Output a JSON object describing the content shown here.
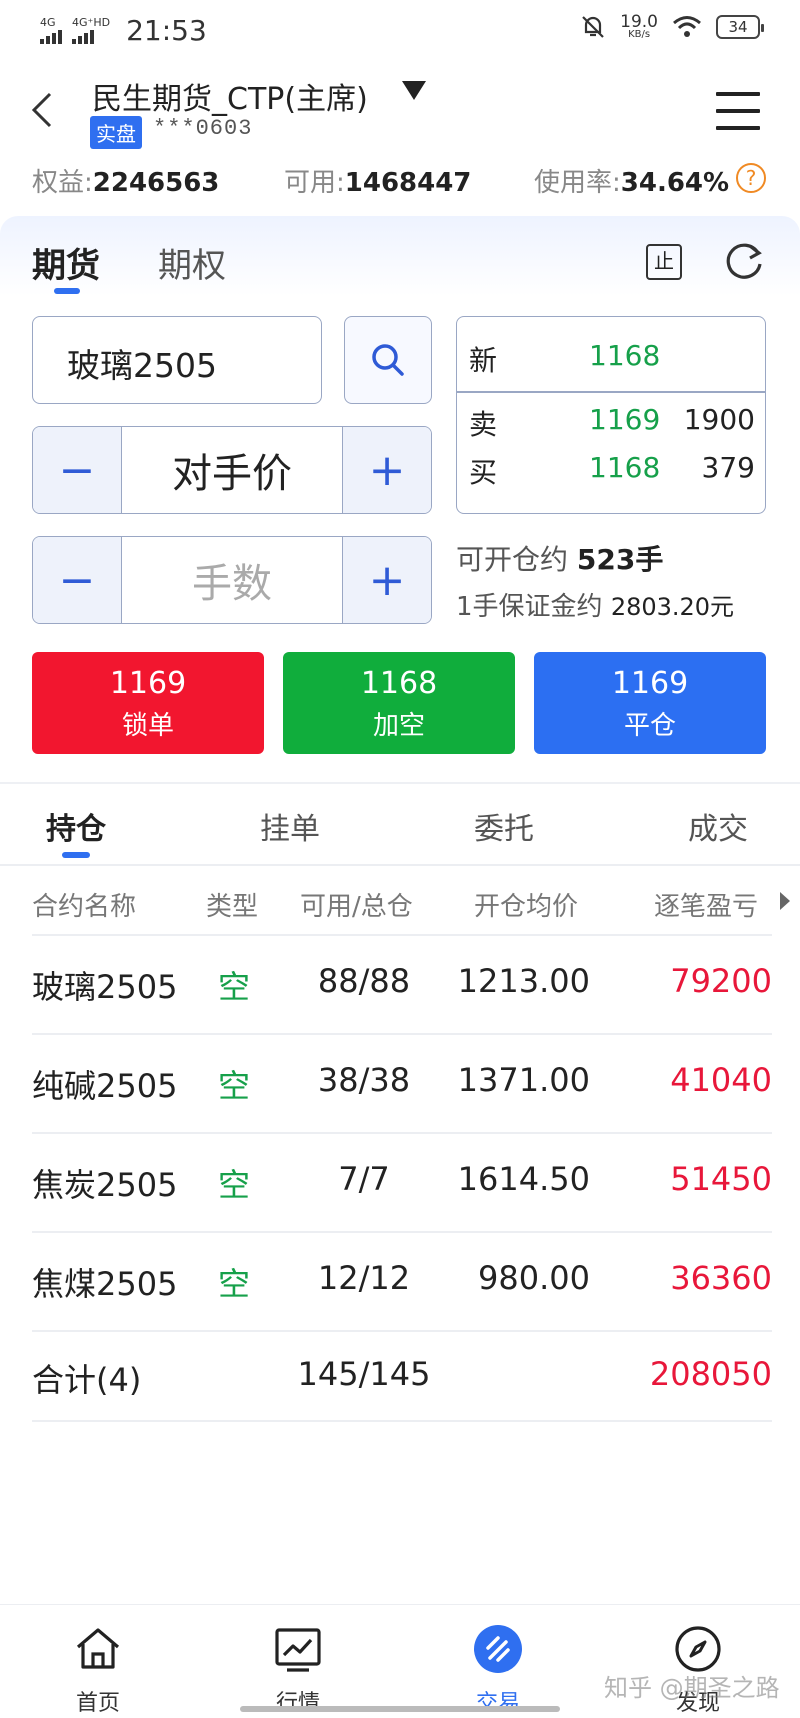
{
  "status_bar": {
    "net1": "4G",
    "net2": "4G⁺HD",
    "time": "21:53",
    "speed_value": "19.0",
    "speed_unit": "KB/s",
    "battery": "34"
  },
  "header": {
    "title": "民生期货_CTP(主席)",
    "badge": "实盘",
    "account": "***0603"
  },
  "stats": {
    "equity_label": "权益:",
    "equity_value": "2246563",
    "available_label": "可用:",
    "available_value": "1468447",
    "usage_label": "使用率:",
    "usage_value": "34.64%",
    "help_glyph": "?"
  },
  "panel_tabs": {
    "futures": "期货",
    "options": "期权",
    "stop_glyph": "止"
  },
  "order_form": {
    "contract": "玻璃2505",
    "price_mode": "对手价",
    "quantity_placeholder": "手数",
    "minus": "−",
    "plus": "+"
  },
  "quote": {
    "last_label": "新",
    "last_price": "1168",
    "ask_label": "卖",
    "ask_price": "1169",
    "ask_volume": "1900",
    "bid_label": "买",
    "bid_price": "1168",
    "bid_volume": "379"
  },
  "info": {
    "can_open_label": "可开仓约",
    "can_open_value": "523手",
    "margin_label": "1手保证金约",
    "margin_value": "2803.20元"
  },
  "actions": [
    {
      "price": "1169",
      "label": "锁单",
      "color": "#f2162f"
    },
    {
      "price": "1168",
      "label": "加空",
      "color": "#10ad3c"
    },
    {
      "price": "1169",
      "label": "平仓",
      "color": "#2c6ff2"
    }
  ],
  "position_tabs": [
    "持仓",
    "挂单",
    "委托",
    "成交"
  ],
  "table": {
    "headers": [
      "合约名称",
      "类型",
      "可用/总仓",
      "开仓均价",
      "逐笔盈亏"
    ],
    "rows": [
      {
        "name": "玻璃2505",
        "type": "空",
        "qty": "88/88",
        "avg_price": "1213.00",
        "pnl": "79200"
      },
      {
        "name": "纯碱2505",
        "type": "空",
        "qty": "38/38",
        "avg_price": "1371.00",
        "pnl": "41040"
      },
      {
        "name": "焦炭2505",
        "type": "空",
        "qty": "7/7",
        "avg_price": "1614.50",
        "pnl": "51450"
      },
      {
        "name": "焦煤2505",
        "type": "空",
        "qty": "12/12",
        "avg_price": "980.00",
        "pnl": "36360"
      }
    ],
    "total": {
      "name": "合计(4)",
      "qty": "145/145",
      "pnl": "208050"
    }
  },
  "bottom_nav": [
    {
      "label": "首页",
      "icon": "home-icon"
    },
    {
      "label": "行情",
      "icon": "chart-icon"
    },
    {
      "label": "交易",
      "icon": "trade-icon",
      "active": true
    },
    {
      "label": "发现",
      "icon": "compass-icon"
    }
  ],
  "watermark": "知乎 @期圣之路",
  "colors": {
    "accent": "#2f6ff0",
    "up_green": "#16a04a",
    "profit_red": "#e8173a"
  }
}
